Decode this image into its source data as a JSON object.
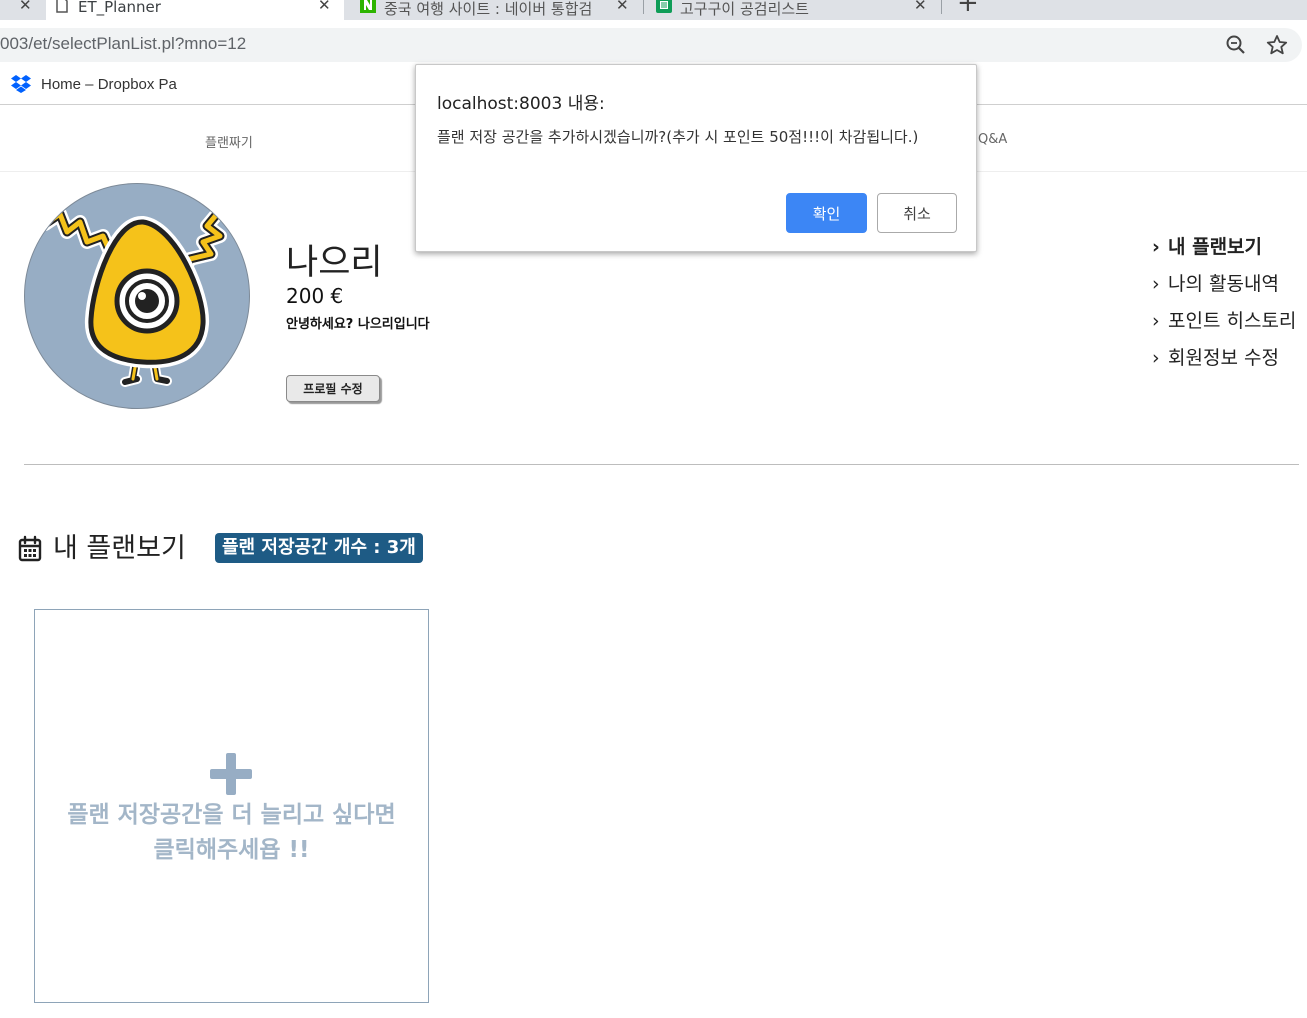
{
  "browser": {
    "tabs": [
      {
        "title": "ET_Planner",
        "active": true
      },
      {
        "title": "중국 여행 사이트 : 네이버 통합검",
        "active": false
      },
      {
        "title": "고구구이 공검리스트",
        "active": false
      }
    ],
    "url": "003/et/selectPlanList.pl?mno=12",
    "bookmarks": [
      {
        "label": "Home – Dropbox Pa",
        "icon": "dropbox-icon"
      }
    ]
  },
  "site_nav": {
    "items": [
      {
        "label": "플랜짜기"
      },
      {
        "label": "Q&A"
      }
    ]
  },
  "profile": {
    "name": "나으리",
    "points": "200 €",
    "greeting": "안녕하세요? 나으리입니다",
    "edit_button": "프로필 수정"
  },
  "side_menu": {
    "items": [
      {
        "label": "내 플랜보기",
        "active": true
      },
      {
        "label": "나의 활동내역",
        "active": false
      },
      {
        "label": "포인트 히스토리",
        "active": false
      },
      {
        "label": "회원정보 수정",
        "active": false
      }
    ]
  },
  "plans_section": {
    "title": "내 플랜보기",
    "storage_badge": "플랜 저장공간 개수 : 3개",
    "add_card": {
      "line1": "플랜 저장공간을 더 늘리고 싶다면",
      "line2": "클릭해주세욥 !!"
    }
  },
  "dialog": {
    "title": "localhost:8003 내용:",
    "message": "플랜 저장 공간을 추가하시겠습니까?(추가 시 포인트 50점!!!이 차감됩니다.)",
    "ok_label": "확인",
    "cancel_label": "취소"
  },
  "colors": {
    "accent_blue": "#3c86f5",
    "badge_navy": "#1e5b85",
    "avatar_bg": "#97adc4",
    "card_text": "#a3b6c8"
  }
}
